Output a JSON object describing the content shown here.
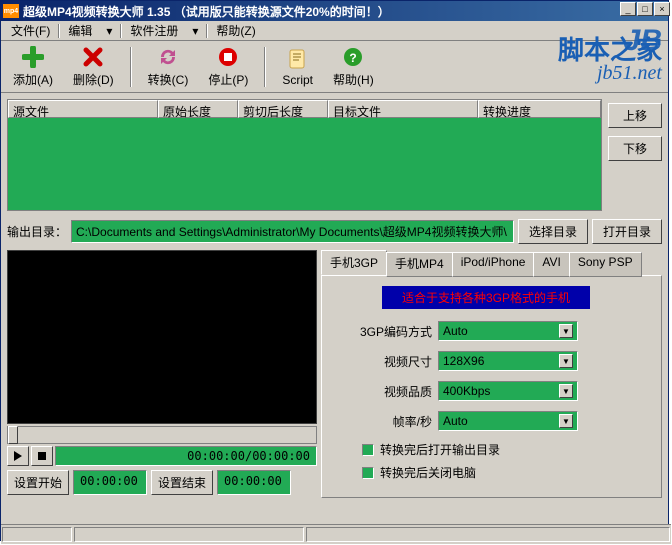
{
  "title": "超级MP4视频转换大师 1.35 （试用版只能转换源文件20%的时间！）",
  "menu": {
    "file": "文件(F)",
    "edit": "编辑",
    "register": "软件注册",
    "help": "帮助(Z)"
  },
  "toolbar": {
    "add": "添加(A)",
    "delete": "删除(D)",
    "convert": "转换(C)",
    "stop": "停止(P)",
    "script": "Script",
    "help": "帮助(H)"
  },
  "watermark": {
    "logo": "JB",
    "text": "脚本之家",
    "url": "jb51.net"
  },
  "columns": {
    "src": "源文件",
    "origlen": "原始长度",
    "cutlen": "剪切后长度",
    "target": "目标文件",
    "progress": "转换进度"
  },
  "side": {
    "up": "上移",
    "down": "下移"
  },
  "output": {
    "label": "输出目录：",
    "path": "C:\\Documents and Settings\\Administrator\\My Documents\\超级MP4视频转换大师\\",
    "select": "选择目录",
    "open": "打开目录"
  },
  "preview": {
    "time": "00:00:00/00:00:00",
    "setstart": "设置开始",
    "starttime": "00:00:00",
    "setend": "设置结束",
    "endtime": "00:00:00"
  },
  "tabs": {
    "t1": "手机3GP",
    "t2": "手机MP4",
    "t3": "iPod/iPhone",
    "t4": "AVI",
    "t5": "Sony PSP"
  },
  "panel": {
    "hint": "适合于支持各种3GP格式的手机",
    "encoding_label": "3GP编码方式",
    "encoding_val": "Auto",
    "size_label": "视频尺寸",
    "size_val": "128X96",
    "quality_label": "视频品质",
    "quality_val": "400Kbps",
    "fps_label": "帧率/秒",
    "fps_val": "Auto",
    "check1": "转换完后打开输出目录",
    "check2": "转换完后关闭电脑"
  }
}
